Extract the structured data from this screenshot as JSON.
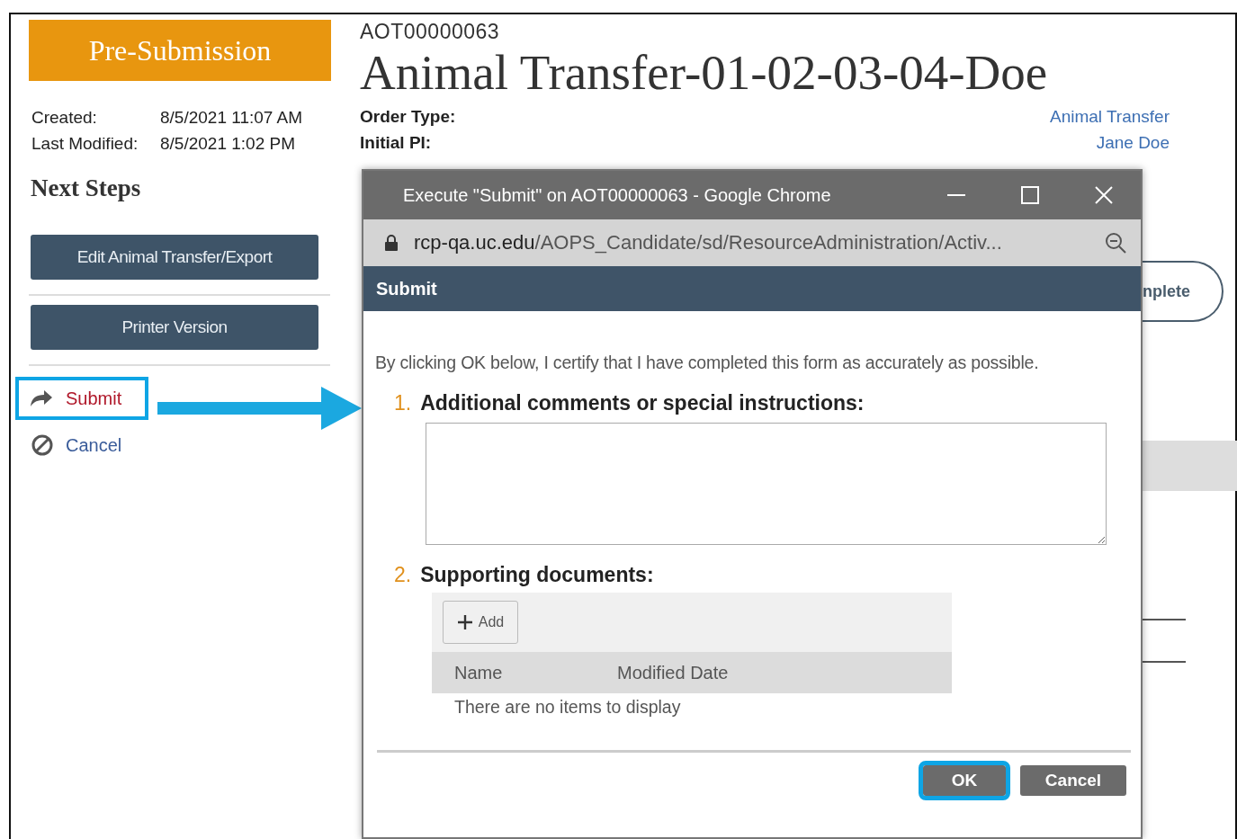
{
  "status": {
    "label": "Pre-Submission"
  },
  "dates": [
    {
      "label": "Created:",
      "value": "8/5/2021 11:07 AM"
    },
    {
      "label": "Last Modified:",
      "value": "8/5/2021 1:02 PM"
    }
  ],
  "next_steps": {
    "title": "Next Steps",
    "buttons": [
      "Edit Animal Transfer/Export",
      "Printer Version"
    ],
    "actions": [
      {
        "kind": "submit",
        "label": "Submit",
        "highlighted": true
      },
      {
        "kind": "cancel",
        "label": "Cancel",
        "highlighted": false
      }
    ]
  },
  "record": {
    "id": "AOT00000063",
    "title": "Animal Transfer-01-02-03-04-Doe",
    "fields": [
      {
        "label": "Order Type:",
        "value": "Animal Transfer"
      },
      {
        "label": "Initial PI:",
        "value": "Jane Doe"
      }
    ],
    "partial_button": "nplete"
  },
  "popup": {
    "window_title": "Execute \"Submit\" on AOT00000063 - Google Chrome",
    "url_host": "rcp-qa.uc.edu",
    "url_path": "/AOPS_Candidate/sd/ResourceAdministration/Activ...",
    "header": "Submit",
    "intro": "By clicking OK below, I certify that I have completed this form as accurately as possible.",
    "questions": [
      {
        "number": "1.",
        "label": "Additional comments or special instructions:",
        "kind": "textarea"
      },
      {
        "number": "2.",
        "label": "Supporting documents:",
        "kind": "documents",
        "add_label": "Add",
        "columns": [
          "Name",
          "Modified Date"
        ],
        "empty_text": "There are no items to display"
      }
    ],
    "buttons": [
      {
        "label": "OK",
        "highlighted": true
      },
      {
        "label": "Cancel",
        "highlighted": false
      }
    ]
  }
}
